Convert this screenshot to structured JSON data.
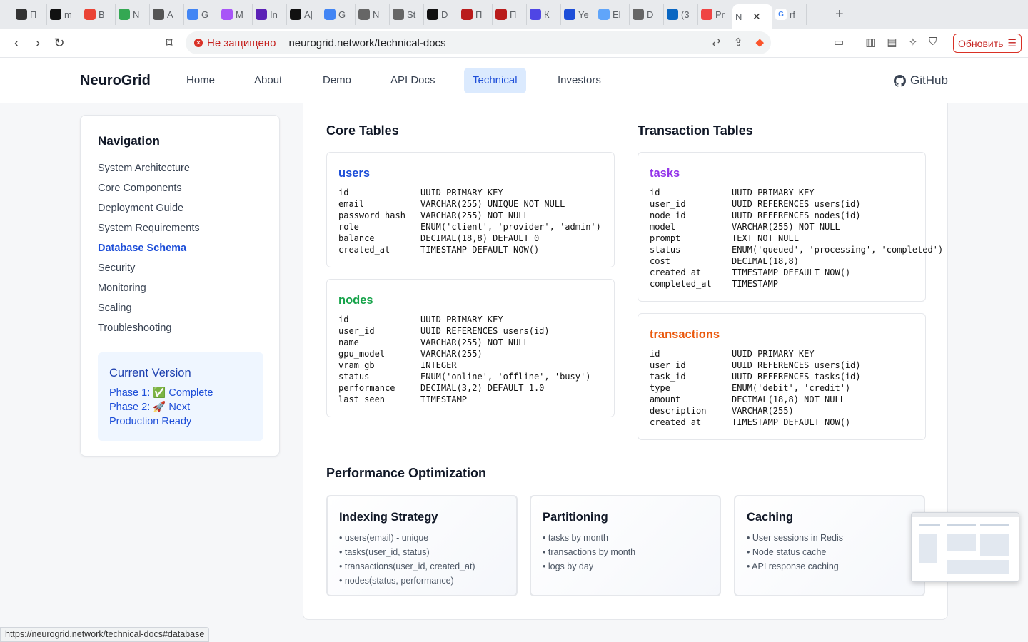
{
  "browser": {
    "tabs": [
      {
        "label": "П",
        "icon": "ai-icon",
        "color": "#333"
      },
      {
        "label": "m",
        "icon": "github-icon",
        "color": "#111"
      },
      {
        "label": "В",
        "icon": "gmail-icon",
        "color": "#ea4335"
      },
      {
        "label": "N",
        "icon": "drive-icon",
        "color": "#34a853"
      },
      {
        "label": "А",
        "icon": "hand-icon",
        "color": "#555"
      },
      {
        "label": "G",
        "icon": "translate-icon",
        "color": "#4285f4"
      },
      {
        "label": "M",
        "icon": "copilot-icon",
        "color": "#a855f7"
      },
      {
        "label": "In",
        "icon": "play-icon",
        "color": "#5b21b6"
      },
      {
        "label": "А|",
        "icon": "openai-icon",
        "color": "#111"
      },
      {
        "label": "G",
        "icon": "gemini-icon",
        "color": "#4285f4"
      },
      {
        "label": "N",
        "icon": "globe-icon",
        "color": "#666"
      },
      {
        "label": "St",
        "icon": "globe-icon",
        "color": "#666"
      },
      {
        "label": "D",
        "icon": "circle-icon",
        "color": "#111"
      },
      {
        "label": "П",
        "icon": "h-icon",
        "color": "#b91c1c"
      },
      {
        "label": "П",
        "icon": "h-icon",
        "color": "#b91c1c"
      },
      {
        "label": "К",
        "icon": "kiwi-icon",
        "color": "#4f46e5"
      },
      {
        "label": "Ye",
        "icon": "grid-icon",
        "color": "#1d4ed8"
      },
      {
        "label": "El",
        "icon": "doc-icon",
        "color": "#60a5fa"
      },
      {
        "label": "D",
        "icon": "globe-icon",
        "color": "#666"
      },
      {
        "label": "(3",
        "icon": "linkedin-icon",
        "color": "#0a66c2"
      },
      {
        "label": "Pr",
        "icon": "p-icon",
        "color": "#ef4444"
      }
    ],
    "active_tab": {
      "label": "N",
      "close": "✕"
    },
    "last_tab": {
      "label": "rf",
      "icon": "google-icon"
    },
    "new_tab": "+",
    "security_label": "Не защищено",
    "url": "neurogrid.network/technical-docs",
    "update_label": "Обновить",
    "status_url": "https://neurogrid.network/technical-docs#database"
  },
  "header": {
    "logo": "NeuroGrid",
    "nav": [
      "Home",
      "About",
      "Demo",
      "API Docs",
      "Technical",
      "Investors"
    ],
    "active_nav": "Technical",
    "github": "GitHub"
  },
  "sidebar": {
    "title": "Navigation",
    "items": [
      "System Architecture",
      "Core Components",
      "Deployment Guide",
      "System Requirements",
      "Database Schema",
      "Security",
      "Monitoring",
      "Scaling",
      "Troubleshooting"
    ],
    "active_item": "Database Schema",
    "version": {
      "title": "Current Version",
      "phase1": "Phase 1: ✅ Complete",
      "phase2": "Phase 2: 🚀 Next",
      "status": "Production Ready"
    }
  },
  "main": {
    "core_title": "Core Tables",
    "transaction_title": "Transaction Tables",
    "tables": {
      "users": {
        "name": "users",
        "color": "#1d4ed8",
        "columns": [
          [
            "id",
            "UUID PRIMARY KEY"
          ],
          [
            "email",
            "VARCHAR(255) UNIQUE NOT NULL"
          ],
          [
            "password_hash",
            "VARCHAR(255) NOT NULL"
          ],
          [
            "role",
            "ENUM('client', 'provider', 'admin')"
          ],
          [
            "balance",
            "DECIMAL(18,8) DEFAULT 0"
          ],
          [
            "created_at",
            "TIMESTAMP DEFAULT NOW()"
          ]
        ]
      },
      "nodes": {
        "name": "nodes",
        "color": "#16a34a",
        "columns": [
          [
            "id",
            "UUID PRIMARY KEY"
          ],
          [
            "user_id",
            "UUID REFERENCES users(id)"
          ],
          [
            "name",
            "VARCHAR(255) NOT NULL"
          ],
          [
            "gpu_model",
            "VARCHAR(255)"
          ],
          [
            "vram_gb",
            "INTEGER"
          ],
          [
            "status",
            "ENUM('online', 'offline', 'busy')"
          ],
          [
            "performance",
            "DECIMAL(3,2) DEFAULT 1.0"
          ],
          [
            "last_seen",
            "TIMESTAMP"
          ]
        ]
      },
      "tasks": {
        "name": "tasks",
        "color": "#9333ea",
        "columns": [
          [
            "id",
            "UUID PRIMARY KEY"
          ],
          [
            "user_id",
            "UUID REFERENCES users(id)"
          ],
          [
            "node_id",
            "UUID REFERENCES nodes(id)"
          ],
          [
            "model",
            "VARCHAR(255) NOT NULL"
          ],
          [
            "prompt",
            "TEXT NOT NULL"
          ],
          [
            "status",
            "ENUM('queued', 'processing', 'completed')"
          ],
          [
            "cost",
            "DECIMAL(18,8)"
          ],
          [
            "created_at",
            "TIMESTAMP DEFAULT NOW()"
          ],
          [
            "completed_at",
            "TIMESTAMP"
          ]
        ]
      },
      "transactions": {
        "name": "transactions",
        "color": "#ea580c",
        "columns": [
          [
            "id",
            "UUID PRIMARY KEY"
          ],
          [
            "user_id",
            "UUID REFERENCES users(id)"
          ],
          [
            "task_id",
            "UUID REFERENCES tasks(id)"
          ],
          [
            "type",
            "ENUM('debit', 'credit')"
          ],
          [
            "amount",
            "DECIMAL(18,8) NOT NULL"
          ],
          [
            "description",
            "VARCHAR(255)"
          ],
          [
            "created_at",
            "TIMESTAMP DEFAULT NOW()"
          ]
        ]
      }
    },
    "perf_title": "Performance Optimization",
    "perf_cards": [
      {
        "title": "Indexing Strategy",
        "items": [
          "• users(email) - unique",
          "• tasks(user_id, status)",
          "• transactions(user_id, created_at)",
          "• nodes(status, performance)"
        ]
      },
      {
        "title": "Partitioning",
        "items": [
          "• tasks by month",
          "• transactions by month",
          "• logs by day"
        ]
      },
      {
        "title": "Caching",
        "items": [
          "• User sessions in Redis",
          "• Node status cache",
          "• API response caching"
        ]
      }
    ]
  }
}
